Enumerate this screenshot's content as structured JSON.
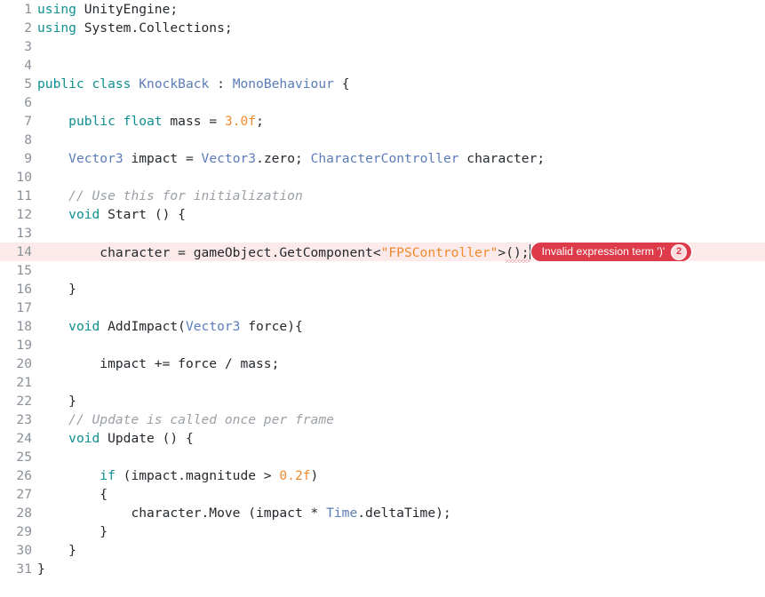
{
  "editor": {
    "language": "csharp",
    "total_lines": 31,
    "background_color": "#ffffff",
    "line_number_color": "#8a9199",
    "error_line_background": "#fceaea",
    "colors": {
      "keyword": "#0f8f8f",
      "type": "#5b7cb8",
      "number": "#f08a2b",
      "string": "#f08a2b",
      "comment": "#9aa0a6",
      "plain_text": "#24292e",
      "error_badge": "#dd3a4a",
      "error_badge_text": "#ffffff",
      "squiggle": "#e8727d"
    }
  },
  "error_badge": {
    "message": "Invalid expression term ')'",
    "count": "2",
    "on_line": 14
  },
  "lines": [
    {
      "n": "1",
      "indent": 0,
      "tokens": [
        {
          "t": "using",
          "c": "kw"
        },
        {
          "t": " UnityEngine;",
          "c": "plain"
        }
      ]
    },
    {
      "n": "2",
      "indent": 0,
      "tokens": [
        {
          "t": "using",
          "c": "kw"
        },
        {
          "t": " System.Collections;",
          "c": "plain"
        }
      ]
    },
    {
      "n": "3",
      "indent": 0,
      "tokens": []
    },
    {
      "n": "4",
      "indent": 0,
      "tokens": []
    },
    {
      "n": "5",
      "indent": 0,
      "tokens": [
        {
          "t": "public",
          "c": "kw"
        },
        {
          "t": " ",
          "c": "plain"
        },
        {
          "t": "class",
          "c": "kw"
        },
        {
          "t": " ",
          "c": "plain"
        },
        {
          "t": "KnockBack",
          "c": "type"
        },
        {
          "t": " : ",
          "c": "plain"
        },
        {
          "t": "MonoBehaviour",
          "c": "type"
        },
        {
          "t": " {",
          "c": "plain"
        }
      ]
    },
    {
      "n": "6",
      "indent": 0,
      "tokens": []
    },
    {
      "n": "7",
      "indent": 1,
      "tokens": [
        {
          "t": "public",
          "c": "kw"
        },
        {
          "t": " ",
          "c": "plain"
        },
        {
          "t": "float",
          "c": "kw"
        },
        {
          "t": " mass = ",
          "c": "plain"
        },
        {
          "t": "3.0f",
          "c": "num"
        },
        {
          "t": ";",
          "c": "plain"
        }
      ]
    },
    {
      "n": "8",
      "indent": 0,
      "tokens": []
    },
    {
      "n": "9",
      "indent": 1,
      "tokens": [
        {
          "t": "Vector3",
          "c": "type"
        },
        {
          "t": " impact = ",
          "c": "plain"
        },
        {
          "t": "Vector3",
          "c": "type"
        },
        {
          "t": ".zero; ",
          "c": "plain"
        },
        {
          "t": "CharacterController",
          "c": "type"
        },
        {
          "t": " character;",
          "c": "plain"
        }
      ]
    },
    {
      "n": "10",
      "indent": 0,
      "tokens": []
    },
    {
      "n": "11",
      "indent": 1,
      "tokens": [
        {
          "t": "// Use this for initialization",
          "c": "comment"
        }
      ]
    },
    {
      "n": "12",
      "indent": 1,
      "tokens": [
        {
          "t": "void",
          "c": "kw"
        },
        {
          "t": " Start () {",
          "c": "plain"
        }
      ]
    },
    {
      "n": "13",
      "indent": 0,
      "tokens": []
    },
    {
      "n": "14",
      "indent": 2,
      "error": true,
      "tokens": [
        {
          "t": "character = gameObject.GetComponent<",
          "c": "plain"
        },
        {
          "t": "\"FPSController\"",
          "c": "str"
        },
        {
          "t": ">",
          "c": "plain"
        },
        {
          "t": "();",
          "c": "plain",
          "squiggle": true
        }
      ]
    },
    {
      "n": "15",
      "indent": 0,
      "tokens": []
    },
    {
      "n": "16",
      "indent": 1,
      "tokens": [
        {
          "t": "}",
          "c": "plain"
        }
      ]
    },
    {
      "n": "17",
      "indent": 0,
      "tokens": []
    },
    {
      "n": "18",
      "indent": 1,
      "tokens": [
        {
          "t": "void",
          "c": "kw"
        },
        {
          "t": " AddImpact(",
          "c": "plain"
        },
        {
          "t": "Vector3",
          "c": "type"
        },
        {
          "t": " force){",
          "c": "plain"
        }
      ]
    },
    {
      "n": "19",
      "indent": 0,
      "tokens": []
    },
    {
      "n": "20",
      "indent": 2,
      "tokens": [
        {
          "t": "impact += force / mass;",
          "c": "plain"
        }
      ]
    },
    {
      "n": "21",
      "indent": 0,
      "tokens": []
    },
    {
      "n": "22",
      "indent": 1,
      "tokens": [
        {
          "t": "}",
          "c": "plain"
        }
      ]
    },
    {
      "n": "23",
      "indent": 1,
      "tokens": [
        {
          "t": "// Update is called once per frame",
          "c": "comment"
        }
      ]
    },
    {
      "n": "24",
      "indent": 1,
      "tokens": [
        {
          "t": "void",
          "c": "kw"
        },
        {
          "t": " Update () {",
          "c": "plain"
        }
      ]
    },
    {
      "n": "25",
      "indent": 0,
      "tokens": []
    },
    {
      "n": "26",
      "indent": 2,
      "tokens": [
        {
          "t": "if",
          "c": "kw"
        },
        {
          "t": " (impact.magnitude > ",
          "c": "plain"
        },
        {
          "t": "0.2f",
          "c": "num"
        },
        {
          "t": ")",
          "c": "plain"
        }
      ]
    },
    {
      "n": "27",
      "indent": 2,
      "tokens": [
        {
          "t": "{",
          "c": "plain"
        }
      ]
    },
    {
      "n": "28",
      "indent": 3,
      "tokens": [
        {
          "t": "character.Move (impact * ",
          "c": "plain"
        },
        {
          "t": "Time",
          "c": "type"
        },
        {
          "t": ".deltaTime);",
          "c": "plain"
        }
      ]
    },
    {
      "n": "29",
      "indent": 2,
      "tokens": [
        {
          "t": "}",
          "c": "plain"
        }
      ]
    },
    {
      "n": "30",
      "indent": 1,
      "tokens": [
        {
          "t": "}",
          "c": "plain"
        }
      ]
    },
    {
      "n": "31",
      "indent": 0,
      "tokens": [
        {
          "t": "}",
          "c": "plain"
        }
      ]
    }
  ]
}
